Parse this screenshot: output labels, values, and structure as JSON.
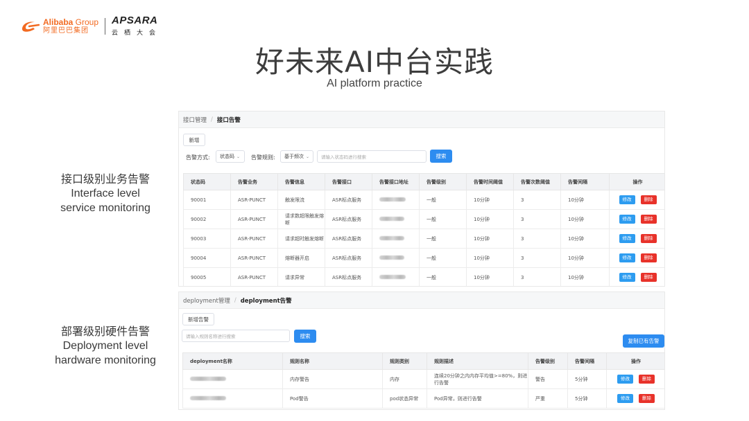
{
  "header": {
    "alibaba_en_brand": "Alibaba",
    "alibaba_en_group": " Group",
    "alibaba_cn": "阿里巴巴集团",
    "apsara_en": "APSARA",
    "apsara_cn": "云栖大会"
  },
  "title": "好未来AI中台实践",
  "subtitle": "AI platform practice",
  "captions": {
    "interface": {
      "cn": "接口级别业务告警",
      "en1": "Interface level",
      "en2": "service monitoring"
    },
    "deployment": {
      "cn": "部署级别硬件告警",
      "en1": "Deployment level",
      "en2": "hardware monitoring"
    }
  },
  "interface_panel": {
    "breadcrumb": [
      "接口管理",
      "接口告警"
    ],
    "breadcrumb_sep": "/",
    "add_button": "新增",
    "filter_type_label": "告警方式:",
    "filter_type_value": "状态码",
    "filter_rule_label": "告警规则:",
    "filter_rule_value": "基于频次",
    "search_placeholder": "请输入状态码进行搜索",
    "search_button": "搜索",
    "columns": [
      "状态码",
      "告警业务",
      "告警信息",
      "告警接口",
      "告警接口地址",
      "告警级别",
      "告警时间阈值",
      "告警次数阈值",
      "告警间隔",
      "操作"
    ],
    "edit_label": "修改",
    "delete_label": "删除",
    "rows": [
      {
        "code": "90001",
        "biz": "ASR-PUNCT",
        "info": "触发限流",
        "api": "ASR标点服务",
        "level": "一般",
        "time": "10分钟",
        "count": "3",
        "interval": "10分钟"
      },
      {
        "code": "90002",
        "biz": "ASR-PUNCT",
        "info": "请求数超限触发熔断",
        "api": "ASR标点服务",
        "level": "一般",
        "time": "10分钟",
        "count": "3",
        "interval": "10分钟"
      },
      {
        "code": "90003",
        "biz": "ASR-PUNCT",
        "info": "请求超时触发熔断",
        "api": "ASR标点服务",
        "level": "一般",
        "time": "10分钟",
        "count": "3",
        "interval": "10分钟"
      },
      {
        "code": "90004",
        "biz": "ASR-PUNCT",
        "info": "熔断器开启",
        "api": "ASR标点服务",
        "level": "一般",
        "time": "10分钟",
        "count": "3",
        "interval": "10分钟"
      },
      {
        "code": "90005",
        "biz": "ASR-PUNCT",
        "info": "请求异常",
        "api": "ASR标点服务",
        "level": "一般",
        "time": "10分钟",
        "count": "3",
        "interval": "10分钟"
      }
    ]
  },
  "deployment_panel": {
    "breadcrumb": [
      "deployment管理",
      "deployment告警"
    ],
    "breadcrumb_sep": "/",
    "add_button": "新增告警",
    "search_placeholder": "请输入规则名称进行搜索",
    "search_button": "搜索",
    "copy_button": "复制已有告警",
    "columns": [
      "deployment名称",
      "规则名称",
      "规则类别",
      "规则描述",
      "告警级别",
      "告警间隔",
      "操作"
    ],
    "edit_label": "修改",
    "delete_label": "删除",
    "rows": [
      {
        "rule": "内存警告",
        "category": "内存",
        "desc": "连续20分钟之内内存平均值>=80%，则进行告警",
        "level": "警告",
        "interval": "5分钟"
      },
      {
        "rule": "Pod警告",
        "category": "pod状态异常",
        "desc": "Pod异常，则进行告警",
        "level": "严重",
        "interval": "5分钟"
      }
    ]
  },
  "colors": {
    "primary": "#2d8cf0",
    "danger": "#e8322a",
    "alibaba_orange": "#f26a21"
  }
}
